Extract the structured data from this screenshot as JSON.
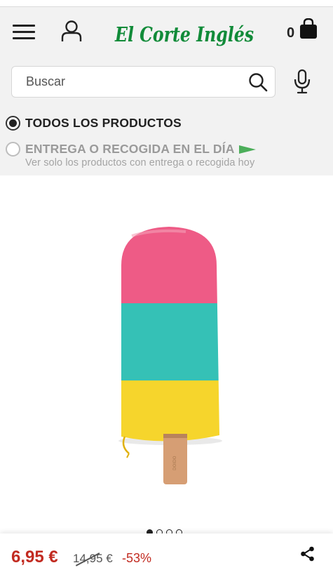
{
  "header": {
    "brand": "El Corte Inglés",
    "cart_count": "0",
    "brand_color": "#118b39"
  },
  "search": {
    "placeholder": "Buscar"
  },
  "filters": {
    "all_products_label": "TODOS LOS PRODUCTOS",
    "same_day_label": "ENTREGA O RECOGIDA EN EL DÍA",
    "same_day_sub": "Ver solo los productos con entrega o recogida hoy",
    "selected": "all_products"
  },
  "product": {
    "image_icon": "popsicle-pencil-case",
    "colors": [
      "#ee5b86",
      "#35c1b6",
      "#f6d52c",
      "#d69e74"
    ],
    "carousel": {
      "total": 4,
      "active": 1
    }
  },
  "pricing": {
    "price": "6,95 €",
    "old_price": "14,95 €",
    "discount": "-53%",
    "accent": "#c22b21"
  }
}
